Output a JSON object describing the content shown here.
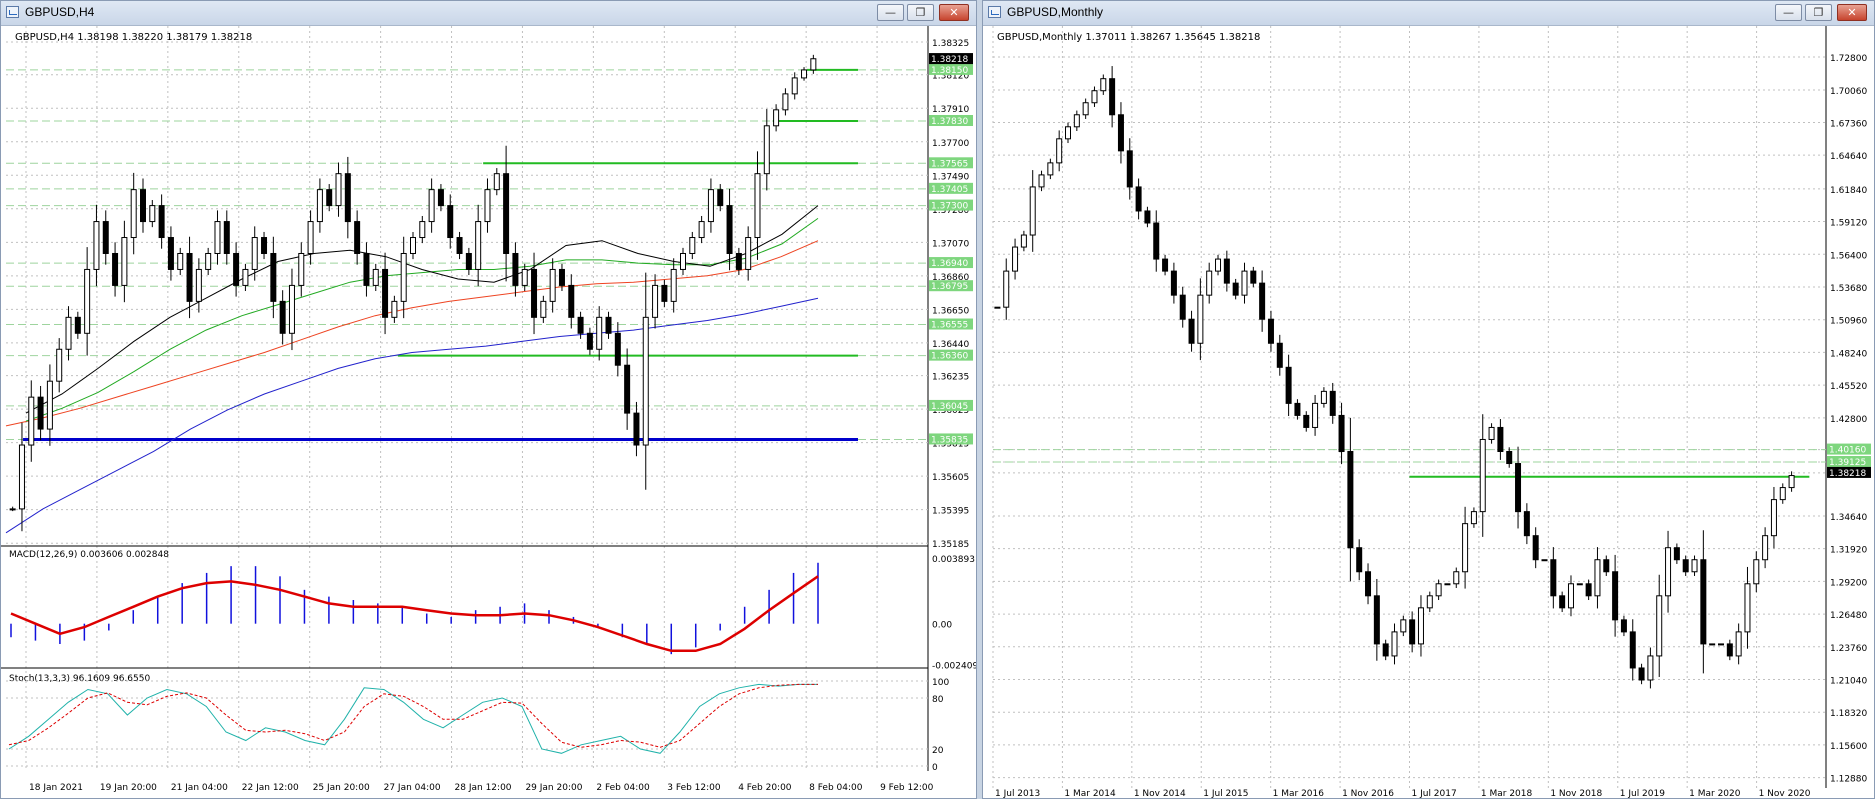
{
  "windows": [
    {
      "title": "GBPUSD,H4"
    },
    {
      "title": "GBPUSD,Monthly"
    }
  ],
  "chart_data": [
    {
      "type": "candlestick",
      "symbol": "GBPUSD",
      "timeframe": "H4",
      "header": "GBPUSD,H4  1.38198 1.38220 1.38179 1.38218",
      "ylim": [
        1.3518,
        1.3835
      ],
      "y_ticks": [
        "1.38325",
        "1.38120",
        "1.37910",
        "1.37700",
        "1.37490",
        "1.37280",
        "1.37070",
        "1.36860",
        "1.36650",
        "1.36440",
        "1.36235",
        "1.36025",
        "1.35815",
        "1.35605",
        "1.35395",
        "1.35185"
      ],
      "x_labels": [
        "18 Jan 2021",
        "19 Jan 20:00",
        "21 Jan 04:00",
        "22 Jan 12:00",
        "25 Jan 20:00",
        "27 Jan 04:00",
        "28 Jan 12:00",
        "29 Jan 20:00",
        "2 Feb 04:00",
        "3 Feb 12:00",
        "4 Feb 20:00",
        "8 Feb 04:00",
        "9 Feb 12:00"
      ],
      "current_price_label": "1.38218",
      "price_level_labels": [
        "1.38150",
        "1.37830",
        "1.37565",
        "1.37405",
        "1.37300",
        "1.36940",
        "1.36795",
        "1.36555",
        "1.36360",
        "1.36045",
        "1.35835"
      ],
      "series": [
        {
          "name": "close",
          "values": [
            1.354,
            1.358,
            1.361,
            1.359,
            1.362,
            1.364,
            1.366,
            1.365,
            1.369,
            1.372,
            1.37,
            1.368,
            1.371,
            1.374,
            1.372,
            1.373,
            1.371,
            1.369,
            1.37,
            1.367,
            1.369,
            1.37,
            1.372,
            1.37,
            1.368,
            1.369,
            1.371,
            1.37,
            1.367,
            1.365,
            1.368,
            1.37,
            1.372,
            1.374,
            1.373,
            1.375,
            1.372,
            1.37,
            1.368,
            1.369,
            1.366,
            1.367,
            1.37,
            1.371,
            1.372,
            1.374,
            1.373,
            1.371,
            1.37,
            1.369,
            1.372,
            1.374,
            1.375,
            1.37,
            1.368,
            1.369,
            1.366,
            1.367,
            1.369,
            1.368,
            1.366,
            1.365,
            1.364,
            1.366,
            1.365,
            1.363,
            1.36,
            1.358,
            1.366,
            1.368,
            1.367,
            1.369,
            1.37,
            1.371,
            1.372,
            1.374,
            1.373,
            1.37,
            1.369,
            1.371,
            1.375,
            1.378,
            1.379,
            1.38,
            1.381,
            1.3815,
            1.3822
          ]
        },
        {
          "name": "SMA fast",
          "values": [
            1.36,
            1.3612,
            1.3628,
            1.3645,
            1.366,
            1.3672,
            1.3684,
            1.3695,
            1.37,
            1.3702,
            1.3698,
            1.369,
            1.3684,
            1.3682,
            1.369,
            1.3705,
            1.3708,
            1.37,
            1.3695,
            1.3692,
            1.37,
            1.3712,
            1.373
          ]
        },
        {
          "name": "SMA mid",
          "values": [
            1.3595,
            1.3603,
            1.3613,
            1.3626,
            1.364,
            1.3652,
            1.3661,
            1.3668,
            1.3675,
            1.3682,
            1.3686,
            1.3688,
            1.369,
            1.369,
            1.3692,
            1.3696,
            1.3696,
            1.3694,
            1.3693,
            1.3693,
            1.3697,
            1.3706,
            1.3722
          ]
        },
        {
          "name": "SMA slow",
          "values": [
            1.3592,
            1.3597,
            1.3603,
            1.361,
            1.3617,
            1.3624,
            1.3631,
            1.3638,
            1.3646,
            1.3654,
            1.3661,
            1.3666,
            1.367,
            1.3673,
            1.3676,
            1.3679,
            1.3681,
            1.3682,
            1.3684,
            1.3686,
            1.369,
            1.3698,
            1.3708
          ]
        },
        {
          "name": "SMA long",
          "values": [
            1.3525,
            1.354,
            1.3552,
            1.3564,
            1.3576,
            1.359,
            1.3602,
            1.3612,
            1.362,
            1.3628,
            1.3634,
            1.3638,
            1.364,
            1.3642,
            1.3645,
            1.3648,
            1.365,
            1.3652,
            1.3655,
            1.3658,
            1.3662,
            1.3667,
            1.3672
          ]
        }
      ],
      "horizontal_levels": [
        {
          "price": 1.3815,
          "color": "#22bb22",
          "from": 0.94,
          "to": 1.0
        },
        {
          "price": 1.3783,
          "color": "#22bb22",
          "from": 0.9,
          "to": 1.0
        },
        {
          "price": 1.37565,
          "color": "#22bb22",
          "from": 0.56,
          "to": 1.0
        },
        {
          "price": 1.3636,
          "color": "#22bb22",
          "from": 0.46,
          "to": 1.0
        },
        {
          "price": 1.35835,
          "color": "#0000cc",
          "from": 0.02,
          "to": 1.0
        }
      ],
      "macd": {
        "label": "MACD(12,26,9) 0.003606 0.002848",
        "y_ticks": [
          "0.003893",
          "0.00",
          "-0.002409"
        ],
        "ylim": [
          -0.0025,
          0.004
        ],
        "histogram": [
          -0.0008,
          -0.001,
          -0.0012,
          -0.001,
          -0.0004,
          0.0008,
          0.0016,
          0.0024,
          0.003,
          0.0034,
          0.0034,
          0.0028,
          0.002,
          0.0016,
          0.0014,
          0.0012,
          0.001,
          0.0006,
          0.0004,
          0.0008,
          0.001,
          0.0012,
          0.0008,
          0.0004,
          -0.0002,
          -0.0008,
          -0.0012,
          -0.0018,
          -0.0014,
          -0.0004,
          0.001,
          0.002,
          0.003,
          0.0036
        ],
        "signal": [
          0.0006,
          0.0,
          -0.0006,
          -0.0002,
          0.0004,
          0.001,
          0.0016,
          0.0021,
          0.0024,
          0.0025,
          0.0023,
          0.002,
          0.0016,
          0.0012,
          0.001,
          0.001,
          0.001,
          0.0008,
          0.0006,
          0.0005,
          0.0005,
          0.0006,
          0.0005,
          0.0002,
          -0.0002,
          -0.0007,
          -0.0012,
          -0.0016,
          -0.0016,
          -0.0012,
          -0.0003,
          0.0008,
          0.0018,
          0.0028
        ]
      },
      "stochastic": {
        "label": "Stoch(13,3,3) 96.1609 96.6550",
        "y_ticks": [
          "100",
          "80",
          "20",
          "0"
        ],
        "k": [
          20,
          35,
          55,
          75,
          90,
          85,
          60,
          80,
          90,
          85,
          70,
          40,
          30,
          45,
          40,
          30,
          25,
          55,
          92,
          90,
          75,
          55,
          45,
          60,
          75,
          80,
          70,
          20,
          15,
          25,
          30,
          35,
          20,
          15,
          40,
          70,
          85,
          92,
          96,
          94,
          96,
          96
        ],
        "d": [
          25,
          30,
          45,
          62,
          80,
          86,
          75,
          72,
          82,
          86,
          80,
          60,
          42,
          40,
          42,
          38,
          30,
          40,
          70,
          85,
          82,
          70,
          55,
          55,
          65,
          75,
          74,
          50,
          28,
          22,
          25,
          30,
          28,
          22,
          30,
          50,
          70,
          85,
          92,
          95,
          96,
          96
        ]
      }
    },
    {
      "type": "candlestick",
      "symbol": "GBPUSD",
      "timeframe": "Monthly",
      "header": "GBPUSD,Monthly  1.37011 1.38267 1.35645 1.38218",
      "ylim": [
        1.1285,
        1.7455
      ],
      "y_ticks": [
        "1.72800",
        "1.70060",
        "1.67360",
        "1.64640",
        "1.61840",
        "1.59120",
        "1.56400",
        "1.53680",
        "1.50960",
        "1.48240",
        "1.45520",
        "1.42800",
        "1.40160",
        "1.39125",
        "1.38218",
        "1.34640",
        "1.31920",
        "1.29200",
        "1.26480",
        "1.23760",
        "1.21040",
        "1.18320",
        "1.15600",
        "1.12880"
      ],
      "x_labels": [
        "1 Jul 2013",
        "1 Mar 2014",
        "1 Nov 2014",
        "1 Jul 2015",
        "1 Mar 2016",
        "1 Nov 2016",
        "1 Jul 2017",
        "1 Mar 2018",
        "1 Nov 2018",
        "1 Jul 2019",
        "1 Mar 2020",
        "1 Nov 2020"
      ],
      "current_price_label": "1.38218",
      "price_level_labels": [
        "1.40160",
        "1.39125"
      ],
      "series": [
        {
          "name": "close",
          "values": [
            1.52,
            1.55,
            1.57,
            1.58,
            1.62,
            1.63,
            1.64,
            1.66,
            1.67,
            1.68,
            1.69,
            1.7,
            1.71,
            1.68,
            1.65,
            1.62,
            1.6,
            1.59,
            1.56,
            1.55,
            1.53,
            1.51,
            1.49,
            1.53,
            1.55,
            1.56,
            1.54,
            1.53,
            1.55,
            1.54,
            1.51,
            1.49,
            1.47,
            1.44,
            1.43,
            1.42,
            1.44,
            1.45,
            1.43,
            1.4,
            1.32,
            1.3,
            1.28,
            1.24,
            1.23,
            1.25,
            1.26,
            1.24,
            1.27,
            1.28,
            1.29,
            1.29,
            1.3,
            1.34,
            1.35,
            1.41,
            1.42,
            1.4,
            1.39,
            1.35,
            1.33,
            1.31,
            1.31,
            1.28,
            1.27,
            1.29,
            1.29,
            1.28,
            1.31,
            1.3,
            1.26,
            1.25,
            1.22,
            1.21,
            1.23,
            1.28,
            1.32,
            1.31,
            1.3,
            1.31,
            1.24,
            1.24,
            1.24,
            1.23,
            1.25,
            1.29,
            1.31,
            1.33,
            1.36,
            1.37,
            1.38
          ]
        }
      ],
      "horizontal_levels": [
        {
          "price": 1.4016,
          "color": "#88cc88",
          "dashed": true
        },
        {
          "price": 1.39125,
          "color": "#88cc88",
          "dashed": true
        },
        {
          "price": 1.379,
          "color": "#22bb22",
          "from": 0.5,
          "to": 0.98
        }
      ]
    }
  ]
}
